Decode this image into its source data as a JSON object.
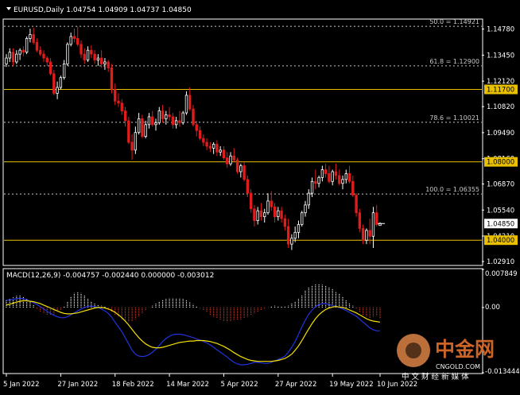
{
  "header": {
    "symbol_line": "EURUSD,Daily  1.04754 1.04909 1.04737 1.04850"
  },
  "chart_data": [
    {
      "type": "candlestick",
      "panel": "price",
      "title": "EURUSD,Daily",
      "ohlc_label": "1.04754 1.04909 1.04737 1.04850",
      "ylim": [
        1.0275,
        1.1525
      ],
      "y_ticks": [
        "1.14780",
        "1.13450",
        "1.12120",
        "1.10820",
        "1.09490",
        "1.08160",
        "1.06870",
        "1.05540",
        "1.04210",
        "1.02910"
      ],
      "current_price": "1.04850",
      "horizontal_lines": [
        {
          "value": 1.117,
          "label": "1.11700",
          "color": "#e8c000"
        },
        {
          "value": 1.08,
          "label": "1.08000",
          "color": "#e8c000"
        },
        {
          "value": 1.04,
          "label": "1.04000",
          "color": "#e8c000"
        }
      ],
      "fib_levels": [
        {
          "value": 1.14921,
          "label": "50.0 = 1.14921"
        },
        {
          "value": 1.129,
          "label": "61.8 = 1.12900"
        },
        {
          "value": 1.10021,
          "label": "78.6 = 1.10021"
        },
        {
          "value": 1.06355,
          "label": "100.0 = 1.06355"
        }
      ],
      "x_ticks": [
        "5 Jan 2022",
        "27 Jan 2022",
        "18 Feb 2022",
        "14 Mar 2022",
        "5 Apr 2022",
        "27 Apr 2022",
        "19 May 2022",
        "10 Jun 2022"
      ],
      "candles": [
        [
          1.13,
          1.135,
          1.1285,
          1.133
        ],
        [
          1.133,
          1.138,
          1.131,
          1.136
        ],
        [
          1.136,
          1.138,
          1.129,
          1.131
        ],
        [
          1.131,
          1.137,
          1.13,
          1.135
        ],
        [
          1.135,
          1.138,
          1.132,
          1.137
        ],
        [
          1.137,
          1.139,
          1.134,
          1.136
        ],
        [
          1.136,
          1.144,
          1.135,
          1.143
        ],
        [
          1.143,
          1.148,
          1.141,
          1.145
        ],
        [
          1.145,
          1.1485,
          1.14,
          1.141
        ],
        [
          1.141,
          1.143,
          1.136,
          1.137
        ],
        [
          1.137,
          1.139,
          1.134,
          1.135
        ],
        [
          1.135,
          1.137,
          1.131,
          1.133
        ],
        [
          1.133,
          1.134,
          1.129,
          1.131
        ],
        [
          1.131,
          1.133,
          1.124,
          1.125
        ],
        [
          1.125,
          1.127,
          1.114,
          1.115
        ],
        [
          1.115,
          1.121,
          1.112,
          1.118
        ],
        [
          1.118,
          1.124,
          1.117,
          1.123
        ],
        [
          1.123,
          1.132,
          1.122,
          1.13
        ],
        [
          1.13,
          1.141,
          1.129,
          1.14
        ],
        [
          1.14,
          1.146,
          1.139,
          1.144
        ],
        [
          1.144,
          1.148,
          1.141,
          1.143
        ],
        [
          1.143,
          1.149,
          1.139,
          1.14
        ],
        [
          1.14,
          1.142,
          1.133,
          1.135
        ],
        [
          1.135,
          1.138,
          1.13,
          1.132
        ],
        [
          1.132,
          1.139,
          1.131,
          1.137
        ],
        [
          1.137,
          1.1395,
          1.133,
          1.135
        ],
        [
          1.135,
          1.137,
          1.13,
          1.132
        ],
        [
          1.132,
          1.135,
          1.129,
          1.133
        ],
        [
          1.133,
          1.137,
          1.128,
          1.13
        ],
        [
          1.13,
          1.133,
          1.127,
          1.131
        ],
        [
          1.131,
          1.132,
          1.126,
          1.128
        ],
        [
          1.128,
          1.13,
          1.115,
          1.117
        ],
        [
          1.117,
          1.12,
          1.109,
          1.111
        ],
        [
          1.111,
          1.115,
          1.108,
          1.11
        ],
        [
          1.11,
          1.112,
          1.104,
          1.106
        ],
        [
          1.106,
          1.108,
          1.098,
          1.101
        ],
        [
          1.101,
          1.103,
          1.089,
          1.09
        ],
        [
          1.09,
          1.094,
          1.081,
          1.086
        ],
        [
          1.086,
          1.098,
          1.084,
          1.095
        ],
        [
          1.095,
          1.105,
          1.094,
          1.102
        ],
        [
          1.102,
          1.104,
          1.092,
          1.093
        ],
        [
          1.093,
          1.101,
          1.092,
          1.099
        ],
        [
          1.099,
          1.105,
          1.097,
          1.103
        ],
        [
          1.103,
          1.106,
          1.098,
          1.099
        ],
        [
          1.099,
          1.102,
          1.096,
          1.1
        ],
        [
          1.1,
          1.108,
          1.099,
          1.106
        ],
        [
          1.106,
          1.109,
          1.1,
          1.102
        ],
        [
          1.102,
          1.106,
          1.099,
          1.104
        ],
        [
          1.104,
          1.108,
          1.101,
          1.103
        ],
        [
          1.103,
          1.105,
          1.097,
          1.099
        ],
        [
          1.099,
          1.103,
          1.097,
          1.101
        ],
        [
          1.101,
          1.106,
          1.098,
          1.1
        ],
        [
          1.1,
          1.106,
          1.099,
          1.105
        ],
        [
          1.105,
          1.116,
          1.104,
          1.114
        ],
        [
          1.114,
          1.118,
          1.106,
          1.107
        ],
        [
          1.107,
          1.109,
          1.098,
          1.099
        ],
        [
          1.099,
          1.101,
          1.093,
          1.096
        ],
        [
          1.096,
          1.098,
          1.091,
          1.092
        ],
        [
          1.092,
          1.094,
          1.088,
          1.09
        ],
        [
          1.09,
          1.092,
          1.086,
          1.088
        ],
        [
          1.088,
          1.09,
          1.085,
          1.087
        ],
        [
          1.087,
          1.09,
          1.084,
          1.089
        ],
        [
          1.089,
          1.091,
          1.083,
          1.085
        ],
        [
          1.085,
          1.088,
          1.083,
          1.086
        ],
        [
          1.086,
          1.088,
          1.081,
          1.082
        ],
        [
          1.082,
          1.085,
          1.077,
          1.079
        ],
        [
          1.079,
          1.085,
          1.078,
          1.083
        ],
        [
          1.083,
          1.087,
          1.08,
          1.081
        ],
        [
          1.081,
          1.082,
          1.074,
          1.075
        ],
        [
          1.075,
          1.079,
          1.072,
          1.078
        ],
        [
          1.078,
          1.08,
          1.07,
          1.071
        ],
        [
          1.071,
          1.073,
          1.062,
          1.064
        ],
        [
          1.064,
          1.066,
          1.054,
          1.056
        ],
        [
          1.056,
          1.058,
          1.047,
          1.05
        ],
        [
          1.05,
          1.057,
          1.048,
          1.055
        ],
        [
          1.055,
          1.059,
          1.05,
          1.052
        ],
        [
          1.052,
          1.056,
          1.049,
          1.054
        ],
        [
          1.054,
          1.064,
          1.053,
          1.06
        ],
        [
          1.06,
          1.065,
          1.055,
          1.057
        ],
        [
          1.057,
          1.059,
          1.049,
          1.052
        ],
        [
          1.052,
          1.057,
          1.05,
          1.055
        ],
        [
          1.055,
          1.057,
          1.049,
          1.051
        ],
        [
          1.051,
          1.053,
          1.045,
          1.047
        ],
        [
          1.047,
          1.051,
          1.036,
          1.038
        ],
        [
          1.038,
          1.043,
          1.035,
          1.041
        ],
        [
          1.041,
          1.047,
          1.039,
          1.044
        ],
        [
          1.044,
          1.05,
          1.041,
          1.048
        ],
        [
          1.048,
          1.055,
          1.047,
          1.054
        ],
        [
          1.054,
          1.06,
          1.052,
          1.058
        ],
        [
          1.058,
          1.066,
          1.056,
          1.064
        ],
        [
          1.064,
          1.072,
          1.062,
          1.07
        ],
        [
          1.07,
          1.076,
          1.066,
          1.069
        ],
        [
          1.069,
          1.073,
          1.067,
          1.072
        ],
        [
          1.072,
          1.078,
          1.07,
          1.076
        ],
        [
          1.076,
          1.079,
          1.072,
          1.074
        ],
        [
          1.074,
          1.078,
          1.069,
          1.07
        ],
        [
          1.07,
          1.076,
          1.068,
          1.075
        ],
        [
          1.075,
          1.079,
          1.071,
          1.073
        ],
        [
          1.073,
          1.076,
          1.068,
          1.069
        ],
        [
          1.069,
          1.073,
          1.066,
          1.071
        ],
        [
          1.071,
          1.076,
          1.069,
          1.074
        ],
        [
          1.074,
          1.078,
          1.069,
          1.07
        ],
        [
          1.07,
          1.073,
          1.062,
          1.063
        ],
        [
          1.063,
          1.064,
          1.052,
          1.054
        ],
        [
          1.054,
          1.056,
          1.044,
          1.046
        ],
        [
          1.046,
          1.048,
          1.038,
          1.04
        ],
        [
          1.04,
          1.046,
          1.038,
          1.045
        ],
        [
          1.045,
          1.051,
          1.038,
          1.042
        ],
        [
          1.042,
          1.057,
          1.036,
          1.054
        ],
        [
          1.054,
          1.058,
          1.047,
          1.048
        ],
        [
          1.0475,
          1.0491,
          1.0474,
          1.0485
        ]
      ]
    },
    {
      "type": "macd",
      "panel": "indicator",
      "label": "MACD(12,26,9) -0.004757 -0.002440 0.000000 -0.003012",
      "ylim": [
        -0.01344,
        0.00785
      ],
      "y_ticks": [
        "0.007849",
        "0.00",
        "-0.013444"
      ],
      "histogram": [
        0.0015,
        0.0018,
        0.0021,
        0.0024,
        0.0025,
        0.0022,
        0.0018,
        0.0012,
        0.0005,
        -0.0002,
        -0.0008,
        -0.0012,
        -0.0015,
        -0.0016,
        -0.0014,
        -0.001,
        -0.0005,
        0.0003,
        0.0012,
        0.0022,
        0.003,
        0.0032,
        0.003,
        0.0025,
        0.0018,
        0.0012,
        0.0008,
        0.0006,
        0.0004,
        0.0002,
        -0.0002,
        -0.0008,
        -0.0015,
        -0.002,
        -0.0024,
        -0.0028,
        -0.003,
        -0.0028,
        -0.0024,
        -0.0018,
        -0.0012,
        -0.0006,
        0.0,
        0.0004,
        0.0008,
        0.0012,
        0.0016,
        0.0018,
        0.002,
        0.002,
        0.0019,
        0.002,
        0.0018,
        0.0015,
        0.0011,
        0.0007,
        0.0003,
        -0.0001,
        -0.0005,
        -0.001,
        -0.0015,
        -0.002,
        -0.0022,
        -0.0025,
        -0.0028,
        -0.003,
        -0.0028,
        -0.0025,
        -0.0026,
        -0.0024,
        -0.0022,
        -0.002,
        -0.0016,
        -0.0012,
        -0.001,
        -0.0006,
        -0.0002,
        0.0,
        0.0003,
        0.0004,
        0.0003,
        0.0002,
        0.0002,
        0.0004,
        0.0008,
        0.0012,
        0.0018,
        0.0026,
        0.0035,
        0.0042,
        0.0046,
        0.0048,
        0.0048,
        0.0047,
        0.0045,
        0.0042,
        0.0038,
        0.0033,
        0.0028,
        0.0022,
        0.0016,
        0.001,
        0.0004,
        -0.0003,
        -0.001,
        -0.0015,
        -0.0019,
        -0.0022,
        -0.002,
        -0.0017,
        -0.0023
      ],
      "macd_line": [
        0.0015,
        0.0016,
        0.0017,
        0.0018,
        0.0019,
        0.0018,
        0.0016,
        0.0013,
        0.001,
        0.0006,
        0.0002,
        -0.0003,
        -0.0008,
        -0.0012,
        -0.0016,
        -0.0019,
        -0.0021,
        -0.0021,
        -0.0019,
        -0.0015,
        -0.0011,
        -0.0007,
        -0.0003,
        0.0,
        0.0002,
        0.0003,
        0.0002,
        0.0,
        -0.0003,
        -0.0007,
        -0.0012,
        -0.002,
        -0.003,
        -0.004,
        -0.005,
        -0.0062,
        -0.0075,
        -0.0088,
        -0.0096,
        -0.01,
        -0.0101,
        -0.01,
        -0.0097,
        -0.0092,
        -0.0086,
        -0.0078,
        -0.007,
        -0.0064,
        -0.0059,
        -0.0056,
        -0.0055,
        -0.0055,
        -0.0056,
        -0.0058,
        -0.006,
        -0.0062,
        -0.0065,
        -0.0067,
        -0.007,
        -0.0073,
        -0.0077,
        -0.0082,
        -0.0087,
        -0.0092,
        -0.0097,
        -0.0102,
        -0.0108,
        -0.0113,
        -0.0116,
        -0.0118,
        -0.0118,
        -0.0117,
        -0.0115,
        -0.0113,
        -0.0113,
        -0.0114,
        -0.0115,
        -0.0115,
        -0.0113,
        -0.011,
        -0.0107,
        -0.0104,
        -0.01,
        -0.0092,
        -0.0082,
        -0.007,
        -0.0055,
        -0.004,
        -0.0026,
        -0.0014,
        -0.0005,
        0.0002,
        0.0006,
        0.0008,
        0.0008,
        0.0006,
        0.0004,
        0.0002,
        0.0,
        -0.0003,
        -0.0006,
        -0.001,
        -0.0014,
        -0.0018,
        -0.0024,
        -0.003,
        -0.0036,
        -0.0042,
        -0.0046,
        -0.0048,
        -0.0048
      ],
      "signal_line": [
        0.0005,
        0.0007,
        0.0009,
        0.0011,
        0.0013,
        0.0014,
        0.0014,
        0.0013,
        0.0012,
        0.001,
        0.0008,
        0.0005,
        0.0002,
        -0.0001,
        -0.0004,
        -0.0007,
        -0.001,
        -0.0012,
        -0.0013,
        -0.0013,
        -0.0012,
        -0.0011,
        -0.0009,
        -0.0007,
        -0.0005,
        -0.0003,
        -0.0001,
        0.0,
        0.0,
        -0.0001,
        -0.0003,
        -0.0006,
        -0.001,
        -0.0015,
        -0.0021,
        -0.0028,
        -0.0036,
        -0.0045,
        -0.0054,
        -0.0062,
        -0.0069,
        -0.0075,
        -0.0079,
        -0.0082,
        -0.0083,
        -0.0083,
        -0.0082,
        -0.008,
        -0.0078,
        -0.0076,
        -0.0074,
        -0.0072,
        -0.0071,
        -0.007,
        -0.0069,
        -0.0069,
        -0.0068,
        -0.0068,
        -0.0068,
        -0.0069,
        -0.007,
        -0.0072,
        -0.0074,
        -0.0077,
        -0.008,
        -0.0084,
        -0.0088,
        -0.0093,
        -0.0097,
        -0.0101,
        -0.0104,
        -0.0107,
        -0.0109,
        -0.011,
        -0.0111,
        -0.0111,
        -0.0111,
        -0.0111,
        -0.0111,
        -0.011,
        -0.0109,
        -0.0107,
        -0.0105,
        -0.0101,
        -0.0096,
        -0.0088,
        -0.0079,
        -0.0068,
        -0.0056,
        -0.0044,
        -0.0033,
        -0.0023,
        -0.0015,
        -0.0009,
        -0.0004,
        -0.0001,
        0.0001,
        0.0002,
        0.0001,
        0.0,
        -0.0002,
        -0.0005,
        -0.0008,
        -0.0011,
        -0.0015,
        -0.0019,
        -0.0023,
        -0.0026,
        -0.0028,
        -0.0029,
        -0.003
      ],
      "colors": {
        "hist_up": "#ffffff",
        "hist_down": "#e03c24",
        "macd": "#2233dd",
        "signal": "#f5e100"
      }
    }
  ],
  "colors": {
    "bull_candle": "#ffffff",
    "bear_candle": "#e01c1c",
    "axis": "#ffffff",
    "grid_fib": "#c8c8c8",
    "price_box_bg": "#ffffff",
    "level_line": "#e8c000"
  },
  "watermark": {
    "brand": "中金网",
    "url": "CNGOLD.COM",
    "tagline": "中 文 财 经 新 媒 体"
  }
}
